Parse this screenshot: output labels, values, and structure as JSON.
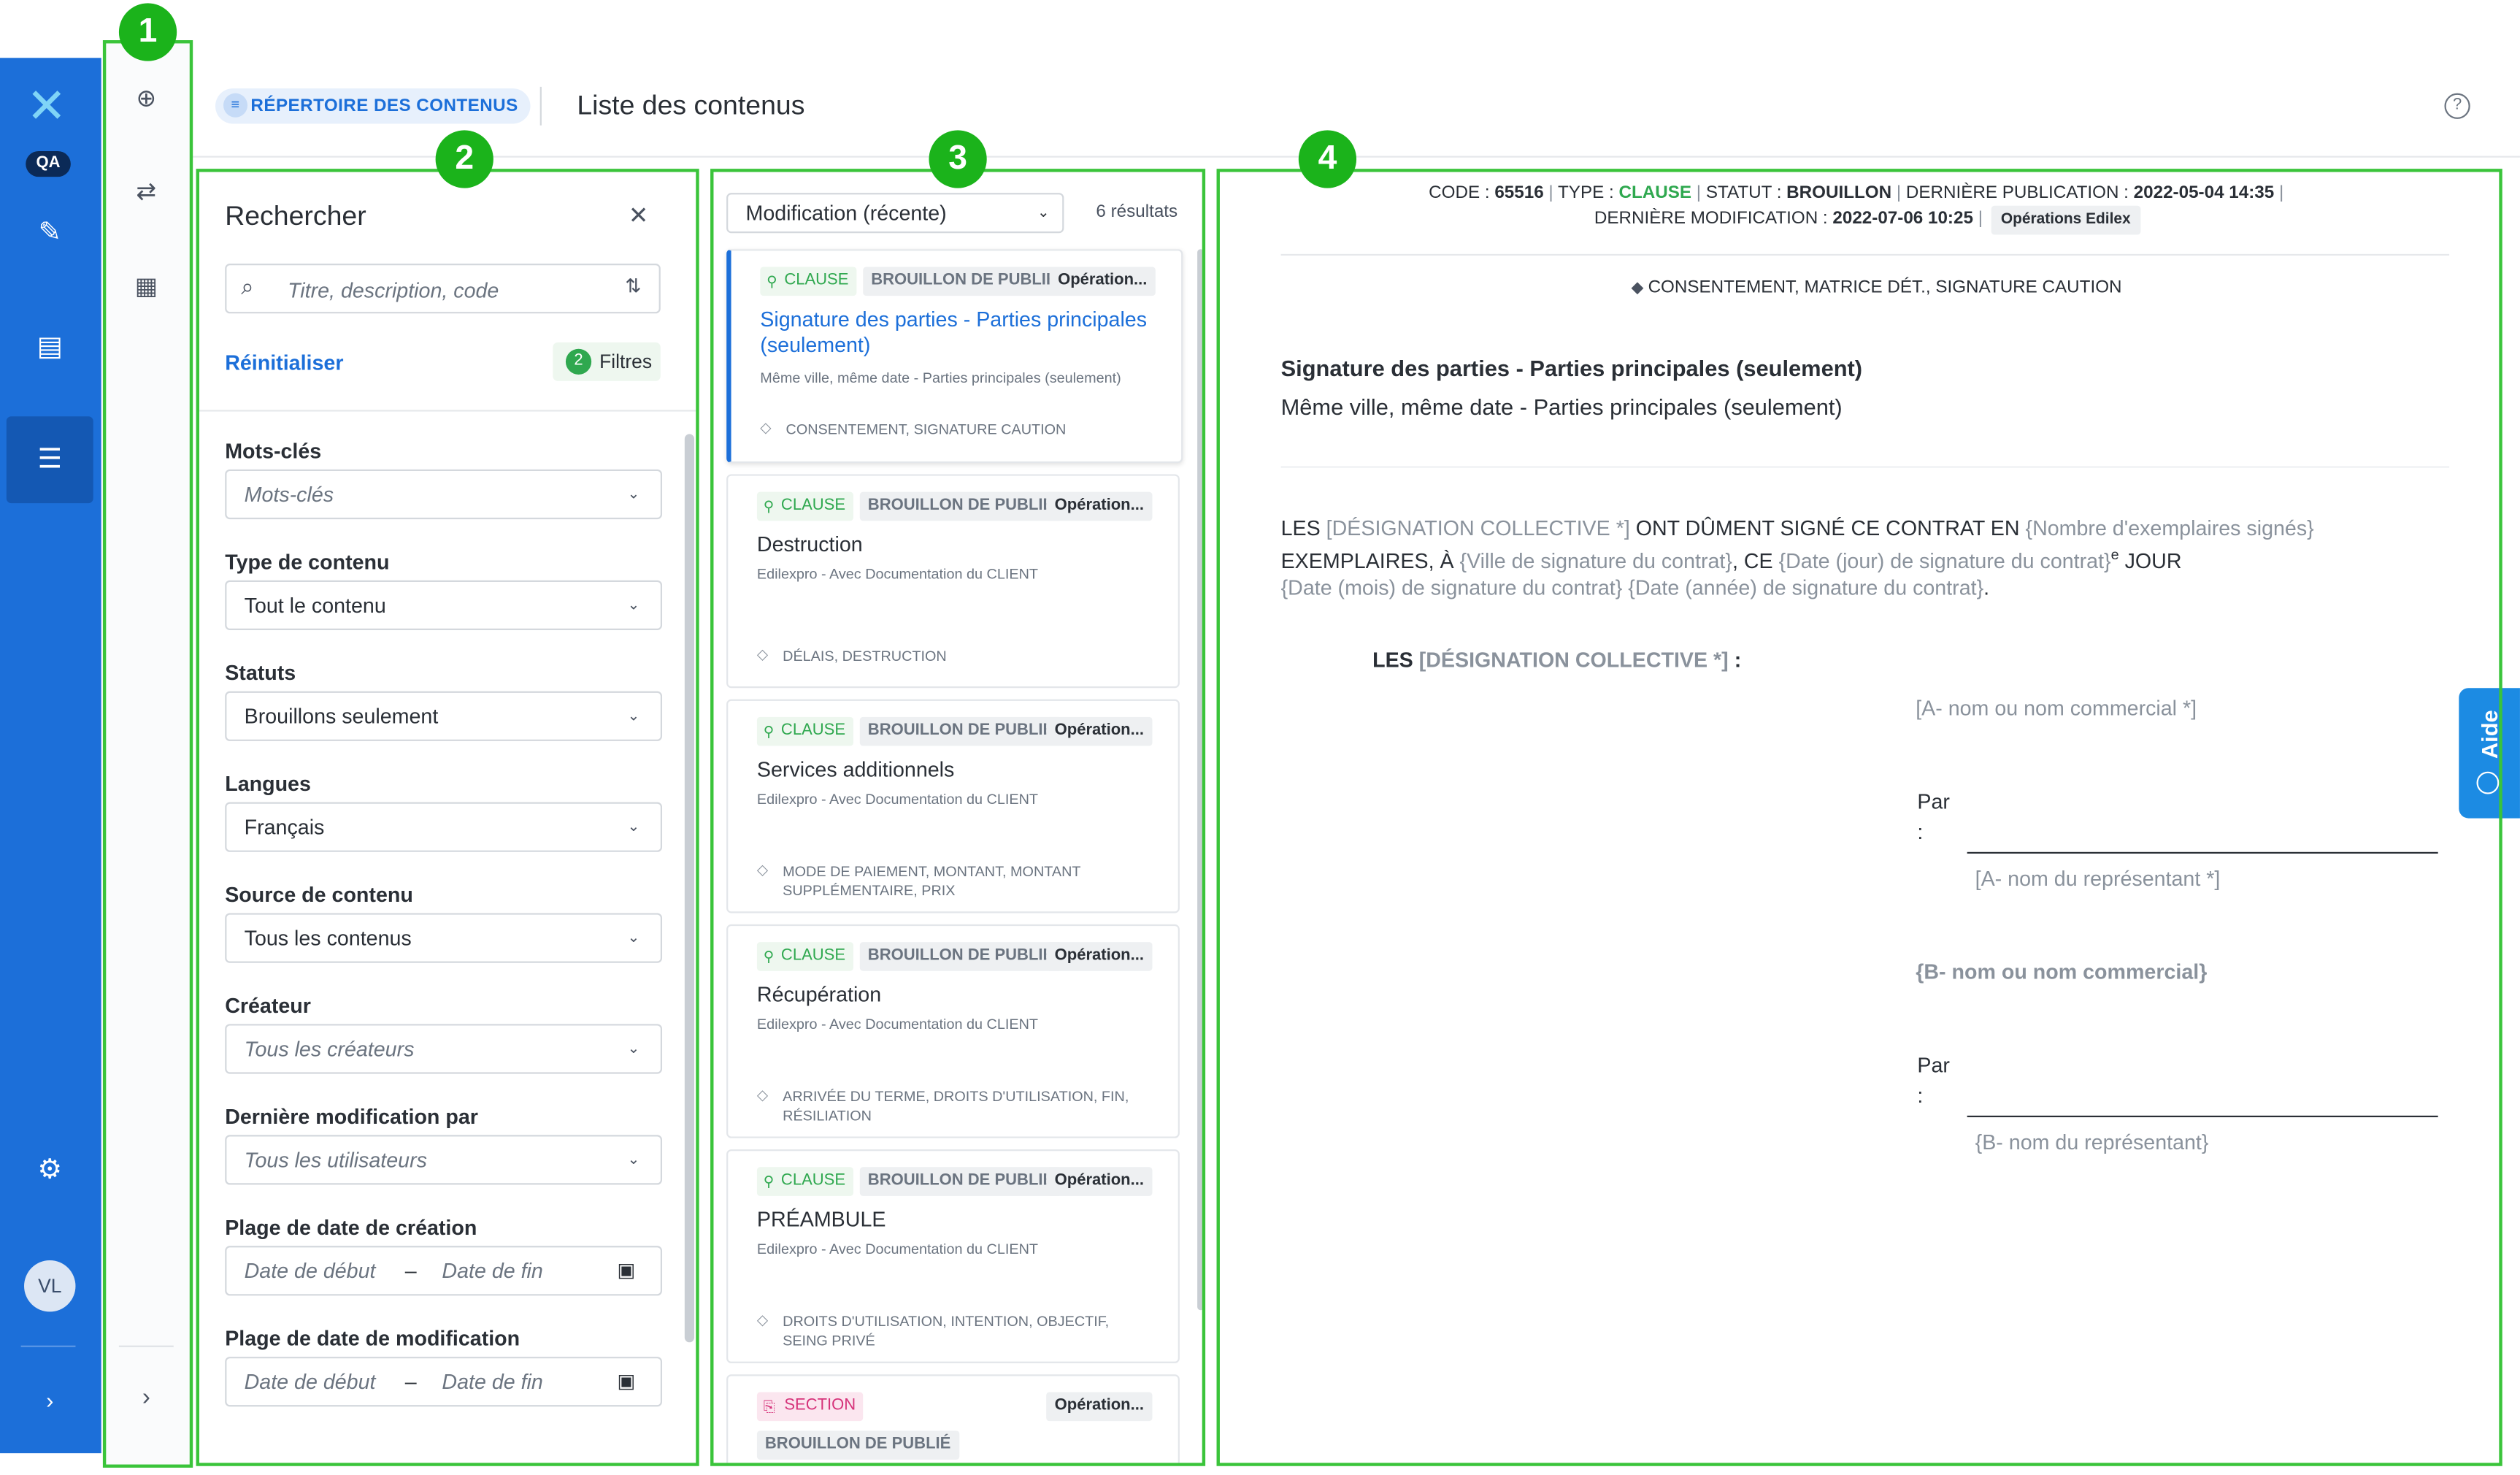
{
  "app": {
    "env_badge": "QA",
    "user_initials": "VL"
  },
  "header": {
    "breadcrumb": "RÉPERTOIRE DES CONTENUS",
    "title": "Liste des contenus"
  },
  "annotations": [
    "1",
    "2",
    "3",
    "4"
  ],
  "search": {
    "title": "Rechercher",
    "input_placeholder": "Titre, description, code",
    "reset_label": "Réinitialiser",
    "filter_count": "2",
    "filter_label": "Filtres",
    "fields": [
      {
        "label": "Mots-clés",
        "value": "Mots-clés",
        "placeholder": true
      },
      {
        "label": "Type de contenu",
        "value": "Tout le contenu",
        "placeholder": false
      },
      {
        "label": "Statuts",
        "value": "Brouillons seulement",
        "placeholder": false
      },
      {
        "label": "Langues",
        "value": "Français",
        "placeholder": false
      },
      {
        "label": "Source de contenu",
        "value": "Tous les contenus",
        "placeholder": false
      },
      {
        "label": "Créateur",
        "value": "Tous les créateurs",
        "placeholder": true
      },
      {
        "label": "Dernière modification par",
        "value": "Tous les utilisateurs",
        "placeholder": true
      }
    ],
    "creation_range": {
      "label": "Plage de date de création",
      "start": "Date de début",
      "sep": "–",
      "end": "Date de fin"
    },
    "modification_range": {
      "label": "Plage de date de modification",
      "start": "Date de début",
      "sep": "–",
      "end": "Date de fin"
    }
  },
  "list": {
    "sort": "Modification (récente)",
    "results": "6 résultats",
    "items": [
      {
        "type": "CLAUSE",
        "status": "BROUILLON DE PUBLIÉ",
        "owner": "Opération...",
        "title": "Signature des parties - Parties principales (seulement)",
        "subtitle": "Même ville, même date - Parties principales (seulement)",
        "keywords": "CONSENTEMENT, SIGNATURE CAUTION"
      },
      {
        "type": "CLAUSE",
        "status": "BROUILLON DE PUBLIÉ",
        "owner": "Opération...",
        "title": "Destruction",
        "subtitle": "Edilexpro - Avec Documentation du CLIENT",
        "keywords": "DÉLAIS, DESTRUCTION"
      },
      {
        "type": "CLAUSE",
        "status": "BROUILLON DE PUBLIÉ",
        "owner": "Opération...",
        "title": "Services additionnels",
        "subtitle": "Edilexpro - Avec Documentation du CLIENT",
        "keywords": "MODE DE PAIEMENT, MONTANT, MONTANT SUPPLÉMENTAIRE, PRIX"
      },
      {
        "type": "CLAUSE",
        "status": "BROUILLON DE PUBLIÉ",
        "owner": "Opération...",
        "title": "Récupération",
        "subtitle": "Edilexpro - Avec Documentation du CLIENT",
        "keywords": "ARRIVÉE DU TERME, DROITS D'UTILISATION, FIN, RÉSILIATION"
      },
      {
        "type": "CLAUSE",
        "status": "BROUILLON DE PUBLIÉ",
        "owner": "Opération...",
        "title": "PRÉAMBULE",
        "subtitle": "Edilexpro - Avec Documentation du CLIENT",
        "keywords": "DROITS D'UTILISATION, INTENTION, OBJECTIF, SEING PRIVÉ"
      },
      {
        "type": "SECTION",
        "status": "BROUILLON DE PUBLIÉ",
        "owner": "Opération..."
      }
    ]
  },
  "preview": {
    "code_label": "CODE :",
    "code": "65516",
    "type_label": "TYPE :",
    "type": "CLAUSE",
    "status_label": "STATUT :",
    "status": "BROUILLON",
    "pub_label": "DERNIÈRE PUBLICATION :",
    "pub": "2022-05-04 14:35",
    "mod_label": "DERNIÈRE MODIFICATION :",
    "mod": "2022-07-06 10:25",
    "owner_badge": "Opérations Edilex",
    "keywords": "CONSENTEMENT, MATRICE DÉT., SIGNATURE CAUTION",
    "title": "Signature des parties - Parties principales (seulement)",
    "subtitle": "Même ville, même date - Parties principales (seulement)",
    "body": {
      "l1a": "LES ",
      "l1b": "[DÉSIGNATION COLLECTIVE *]",
      "l1c": " ONT DÛMENT SIGNÉ CE CONTRAT EN ",
      "l1d": "{Nombre d'exemplaires signés}",
      "l2a": "EXEMPLAIRES, À ",
      "l2b": "{Ville de signature du contrat}",
      "l2c": ", CE ",
      "l2d": "{Date (jour) de signature du contrat}",
      "l2e": "e",
      "l2f": " JOUR",
      "l3a": "{Date (mois) de signature du contrat}",
      "l3b": " {Date (année) de signature du contrat}",
      "l3c": "."
    },
    "party_a_header_a": "LES ",
    "party_a_header_b": "[DÉSIGNATION COLLECTIVE *]",
    "party_a_header_c": " :",
    "party_a_name": "[A- nom ou nom commercial *]",
    "par_label": "Par",
    "colon": ":",
    "party_a_rep": "[A- nom du représentant *]",
    "party_b_name": "{B- nom ou nom commercial}",
    "party_b_rep": "{B- nom du représentant}"
  },
  "help": {
    "label": "Aide"
  },
  "colors": {
    "primary": "#1c6fd9",
    "annotation": "#3ac43a",
    "clause": "#2fa84f",
    "section": "#d6337a"
  }
}
